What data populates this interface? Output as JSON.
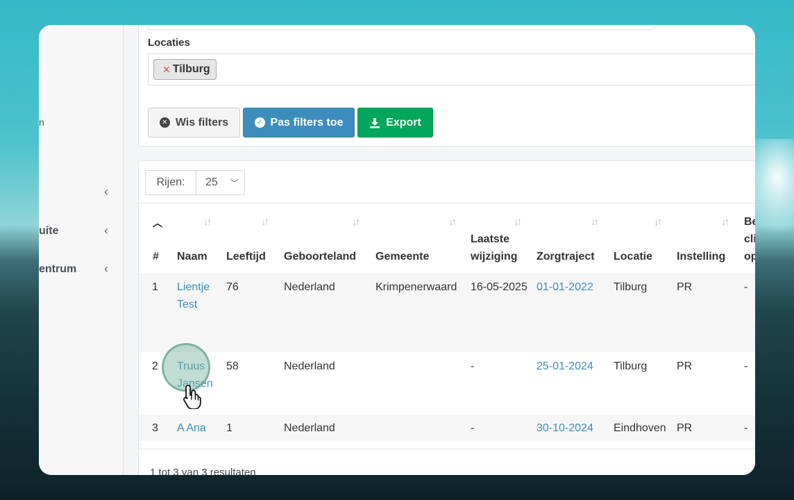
{
  "sidebar": {
    "fragment": "n",
    "items": [
      {
        "label": ""
      },
      {
        "label": "uite"
      },
      {
        "label": "entrum"
      }
    ],
    "chevron": "‹"
  },
  "filters": {
    "locations_label": "Locaties",
    "selected_tag": "Tilburg",
    "clear_label": "Wis filters",
    "apply_label": "Pas filters toe",
    "export_label": "Export"
  },
  "table": {
    "rows_label": "Rijen:",
    "rows_value": "25",
    "columns": [
      {
        "key": "num",
        "label": "#"
      },
      {
        "key": "naam",
        "label": "Naam"
      },
      {
        "key": "leeftijd",
        "label": "Leeftijd"
      },
      {
        "key": "geboorteland",
        "label": "Geboorteland"
      },
      {
        "key": "gemeente",
        "label": "Gemeente"
      },
      {
        "key": "laatste",
        "label_line1": "Laatste",
        "label_line2": "wijziging"
      },
      {
        "key": "zorgtraject",
        "label": "Zorgtraject"
      },
      {
        "key": "locatie",
        "label": "Locatie"
      },
      {
        "key": "instelling",
        "label": "Instelling"
      },
      {
        "key": "extra",
        "label_line1": "Be",
        "label_line2": "cli",
        "label_line3": "op"
      }
    ],
    "rows": [
      {
        "num": "1",
        "naam_line1": "Lientje",
        "naam_line2": "Test",
        "leeftijd": "76",
        "geboorteland": "Nederland",
        "gemeente": "Krimpenerwaard",
        "laatste": "16-05-2025",
        "zorgtraject": "01-01-2022",
        "locatie": "Tilburg",
        "instelling": "PR",
        "extra": "-"
      },
      {
        "num": "2",
        "naam_line1": "Truus",
        "naam_line2": "Jansen",
        "leeftijd": "58",
        "geboorteland": "Nederland",
        "gemeente": "",
        "laatste": "-",
        "zorgtraject": "25-01-2024",
        "locatie": "Tilburg",
        "instelling": "PR",
        "extra": "-"
      },
      {
        "num": "3",
        "naam_line1": "A Ana",
        "naam_line2": "",
        "leeftijd": "1",
        "geboorteland": "Nederland",
        "gemeente": "",
        "laatste": "-",
        "zorgtraject": "30-10-2024",
        "locatie": "Eindhoven",
        "instelling": "PR",
        "extra": "-"
      }
    ],
    "footer": "1 tot 3 van 3 resultaten"
  }
}
